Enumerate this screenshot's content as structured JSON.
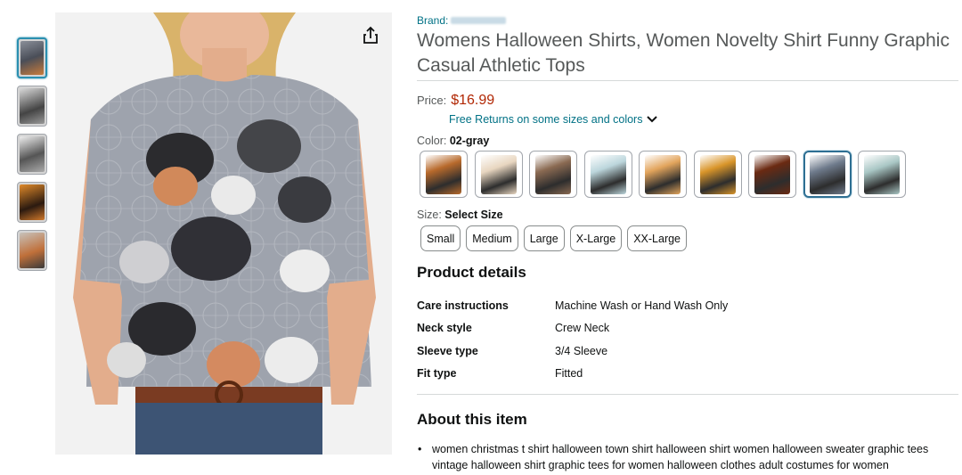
{
  "brand": {
    "label": "Brand:"
  },
  "product": {
    "title": "Womens Halloween Shirts, Women Novelty Shirt Funny Graphic Casual Athletic Tops"
  },
  "price": {
    "label": "Price:",
    "value": "$16.99",
    "returns_text": "Free Returns on some sizes and colors"
  },
  "color": {
    "label": "Color:",
    "selected": "02-gray",
    "swatch_colors": [
      "#b86a2c",
      "#e8d6c0",
      "#8a6a52",
      "#bcd6dc",
      "#e2a45c",
      "#d9952a",
      "#6b2a12",
      "#6f7b8c",
      "#a9c7c5"
    ],
    "selected_index": 7
  },
  "size": {
    "label": "Size:",
    "selected": "Select Size",
    "options": [
      "Small",
      "Medium",
      "Large",
      "X-Large",
      "XX-Large"
    ]
  },
  "details": {
    "heading": "Product details",
    "rows": [
      {
        "key": "Care instructions",
        "value": "Machine Wash or Hand Wash Only"
      },
      {
        "key": "Neck style",
        "value": "Crew Neck"
      },
      {
        "key": "Sleeve type",
        "value": "3/4 Sleeve"
      },
      {
        "key": "Fit type",
        "value": "Fitted"
      }
    ]
  },
  "about": {
    "heading": "About this item",
    "bullets": [
      "women christmas t shirt halloween town shirt halloween shirt women halloween sweater graphic tees vintage halloween shirt graphic tees for women halloween clothes adult costumes for women"
    ]
  },
  "thumbnails": {
    "colors": [
      "#7e8290",
      "#5a5a5a",
      "#6b6b6b",
      "#c6742c",
      "#b9845a"
    ],
    "selected_index": 0
  },
  "icons": {
    "share": "share-icon",
    "chevron": "chevron-down-icon"
  }
}
